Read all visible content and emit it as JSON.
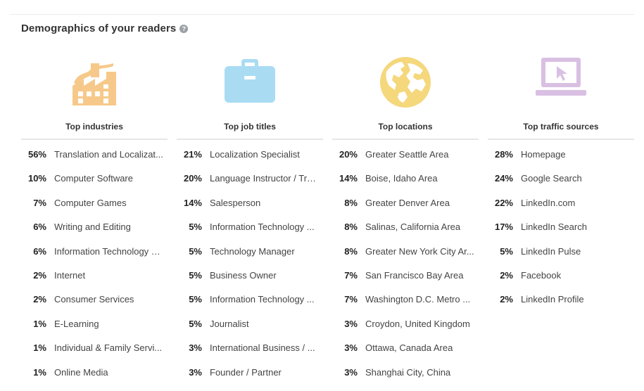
{
  "header": {
    "title": "Demographics of your readers",
    "help_glyph": "?"
  },
  "colors": {
    "factory": "#f6c98a",
    "briefcase": "#a9dcf3",
    "globe": "#f5d77c",
    "laptop": "#d9c0e3"
  },
  "columns": [
    {
      "title": "Top industries",
      "icon": "factory-icon",
      "rows": [
        {
          "pct": "56%",
          "label": "Translation and Localizat..."
        },
        {
          "pct": "10%",
          "label": "Computer Software"
        },
        {
          "pct": "7%",
          "label": "Computer Games"
        },
        {
          "pct": "6%",
          "label": "Writing and Editing"
        },
        {
          "pct": "6%",
          "label": "Information Technology a..."
        },
        {
          "pct": "2%",
          "label": "Internet"
        },
        {
          "pct": "2%",
          "label": "Consumer Services"
        },
        {
          "pct": "1%",
          "label": "E-Learning"
        },
        {
          "pct": "1%",
          "label": "Individual & Family Servi..."
        },
        {
          "pct": "1%",
          "label": "Online Media"
        }
      ]
    },
    {
      "title": "Top job titles",
      "icon": "briefcase-icon",
      "rows": [
        {
          "pct": "21%",
          "label": "Localization Specialist"
        },
        {
          "pct": "20%",
          "label": "Language Instructor / Tra..."
        },
        {
          "pct": "14%",
          "label": "Salesperson"
        },
        {
          "pct": "5%",
          "label": "Information Technology ..."
        },
        {
          "pct": "5%",
          "label": "Technology Manager"
        },
        {
          "pct": "5%",
          "label": "Business Owner"
        },
        {
          "pct": "5%",
          "label": "Information Technology ..."
        },
        {
          "pct": "5%",
          "label": "Journalist"
        },
        {
          "pct": "3%",
          "label": "International Business / ..."
        },
        {
          "pct": "3%",
          "label": "Founder / Partner"
        }
      ]
    },
    {
      "title": "Top locations",
      "icon": "globe-icon",
      "rows": [
        {
          "pct": "20%",
          "label": "Greater Seattle Area"
        },
        {
          "pct": "14%",
          "label": "Boise, Idaho Area"
        },
        {
          "pct": "8%",
          "label": "Greater Denver Area"
        },
        {
          "pct": "8%",
          "label": "Salinas, California Area"
        },
        {
          "pct": "8%",
          "label": "Greater New York City Ar..."
        },
        {
          "pct": "7%",
          "label": "San Francisco Bay Area"
        },
        {
          "pct": "7%",
          "label": "Washington D.C. Metro ..."
        },
        {
          "pct": "3%",
          "label": "Croydon, United Kingdom"
        },
        {
          "pct": "3%",
          "label": "Ottawa, Canada Area"
        },
        {
          "pct": "3%",
          "label": "Shanghai City, China"
        }
      ]
    },
    {
      "title": "Top traffic sources",
      "icon": "laptop-icon",
      "rows": [
        {
          "pct": "28%",
          "label": "Homepage"
        },
        {
          "pct": "24%",
          "label": "Google Search"
        },
        {
          "pct": "22%",
          "label": "LinkedIn.com"
        },
        {
          "pct": "17%",
          "label": "LinkedIn Search"
        },
        {
          "pct": "5%",
          "label": "LinkedIn Pulse"
        },
        {
          "pct": "2%",
          "label": "Facebook"
        },
        {
          "pct": "2%",
          "label": "LinkedIn Profile"
        }
      ]
    }
  ]
}
